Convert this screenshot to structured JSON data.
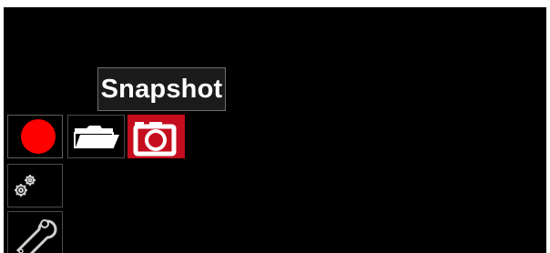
{
  "tooltip": {
    "text": "Snapshot"
  },
  "toolbar": {
    "items": [
      {
        "name": "record",
        "icon": "record-icon",
        "selected": false
      },
      {
        "name": "open-folder",
        "icon": "folder-icon",
        "selected": false
      },
      {
        "name": "snapshot",
        "icon": "camera-icon",
        "selected": true
      }
    ]
  },
  "side_menu": {
    "items": [
      {
        "name": "settings",
        "icon": "gears-icon"
      },
      {
        "name": "tools",
        "icon": "wrench-icon"
      }
    ]
  },
  "colors": {
    "background": "#000000",
    "selected": "#c40d1e",
    "record": "#ff0000",
    "icon": "#ffffff",
    "tile_border": "#4a4a4a"
  }
}
